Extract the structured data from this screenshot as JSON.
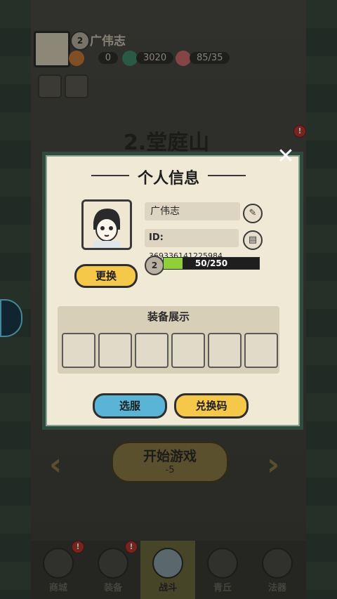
{
  "top_bar": {
    "level": "2",
    "player_name": "广伟志",
    "resources": [
      {
        "icon": "coin-icon",
        "value": "0"
      },
      {
        "icon": "jade-icon",
        "value": "3020"
      },
      {
        "icon": "peach-energy-icon",
        "value": "85/35"
      }
    ]
  },
  "stage": {
    "title": "2.堂庭山"
  },
  "start_game": {
    "label": "开始游戏",
    "cost": "-5"
  },
  "bottom_nav": [
    {
      "label": "商城",
      "icon": "shop-icon",
      "badge": "!"
    },
    {
      "label": "装备",
      "icon": "helmet-icon",
      "badge": "!"
    },
    {
      "label": "战斗",
      "icon": "crossed-swords-icon",
      "active": true
    },
    {
      "label": "青丘",
      "icon": "mountain-icon"
    },
    {
      "label": "法器",
      "icon": "artifact-icon"
    }
  ],
  "dialog": {
    "title": "个人信息",
    "name": "广伟志",
    "id_label": "ID:",
    "id_value": "369336141225984",
    "level": "2",
    "exp": {
      "current": 50,
      "max": 250,
      "text": "50/250"
    },
    "change_button": "更换",
    "equip_section_title": "装备展示",
    "equip_slots": 6,
    "server_button": "选服",
    "redeem_button": "兑换码"
  },
  "colors": {
    "exp_fill": "#8fcf3a",
    "yellow_button": "#f5c84a",
    "blue_button": "#59b4d6"
  }
}
